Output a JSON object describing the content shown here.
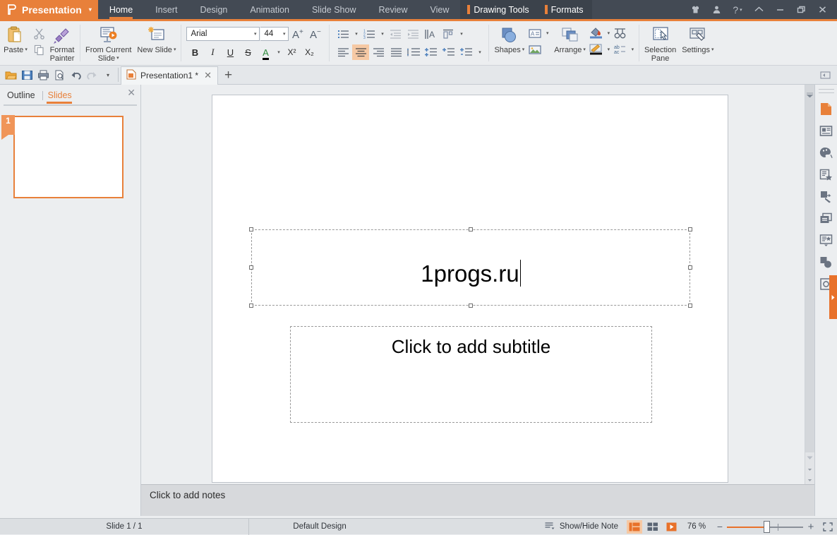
{
  "app": {
    "brand": "Presentation",
    "brand_caret": "▾",
    "accent": "#e8803a",
    "titlebar_bg": "#434a54"
  },
  "titlebar": {
    "tabs": [
      {
        "label": "Home",
        "active": true
      },
      {
        "label": "Insert",
        "active": false
      },
      {
        "label": "Design",
        "active": false
      },
      {
        "label": "Animation",
        "active": false
      },
      {
        "label": "Slide Show",
        "active": false
      },
      {
        "label": "Review",
        "active": false
      },
      {
        "label": "View",
        "active": false
      }
    ],
    "context_tabs": [
      {
        "label": "Drawing Tools"
      },
      {
        "label": "Formats"
      }
    ],
    "controls": [
      {
        "name": "skin-icon"
      },
      {
        "name": "user-account-icon"
      },
      {
        "name": "help-icon"
      },
      {
        "name": "collapse-ribbon-icon"
      },
      {
        "name": "minimize-icon"
      },
      {
        "name": "restore-icon"
      },
      {
        "name": "close-icon"
      }
    ]
  },
  "ribbon": {
    "paste": "Paste",
    "paste_caret": "▾",
    "cut": "cut-scissors-icon",
    "copy": "copy-icon",
    "format_painter_line1": "Format",
    "format_painter_line2": "Painter",
    "from_current_line1": "From Current",
    "from_current_line2": "Slide",
    "from_current_caret": "▾",
    "new_slide": "New Slide",
    "new_slide_caret": "▾",
    "font_name": "Arial",
    "font_size": "44",
    "grow_font": "A⁺",
    "shrink_font": "A⁻",
    "bold": "B",
    "italic": "I",
    "underline": "U",
    "strike": "S",
    "font_color": "A",
    "superscript": "X²",
    "subscript": "X₂",
    "shapes": "Shapes",
    "shapes_caret": "▾",
    "arrange": "Arrange",
    "arrange_caret": "▾",
    "selection_pane_line1": "Selection",
    "selection_pane_line2": "Pane",
    "settings": "Settings",
    "settings_caret": "▾"
  },
  "qat": {
    "buttons": [
      {
        "name": "open-icon"
      },
      {
        "name": "save-icon"
      },
      {
        "name": "print-icon"
      },
      {
        "name": "print-preview-icon"
      },
      {
        "name": "undo-icon"
      },
      {
        "name": "redo-icon"
      },
      {
        "name": "customize-qat-caret"
      }
    ],
    "doc_tab": "Presentation1 *",
    "doc_tab_close": "✕",
    "new_tab": "+"
  },
  "left_panel": {
    "tab_outline": "Outline",
    "tab_slides": "Slides",
    "active_tab": "Slides",
    "close": "✕",
    "slides": [
      {
        "number": "1"
      }
    ]
  },
  "slide": {
    "title_text": "1progs.ru",
    "subtitle_placeholder": "Click to add subtitle",
    "title_selected": true
  },
  "notes": {
    "placeholder": "Click to add notes"
  },
  "right_rail": {
    "buttons": [
      {
        "name": "slide-setup-icon",
        "active": true
      },
      {
        "name": "slide-layout-icon",
        "active": false
      },
      {
        "name": "design-palette-icon",
        "active": false
      },
      {
        "name": "animation-star-icon",
        "active": false
      },
      {
        "name": "insert-object-icon",
        "active": false
      },
      {
        "name": "window-arrange-icon",
        "active": false
      },
      {
        "name": "template-star-icon",
        "active": false
      },
      {
        "name": "shape-style-icon",
        "active": false
      },
      {
        "name": "image-transform-icon",
        "active": false
      }
    ]
  },
  "status": {
    "slide_count": "Slide 1 / 1",
    "design": "Default Design",
    "show_hide_note": "Show/Hide Note",
    "zoom_level": "76 %",
    "zoom_out": "−",
    "zoom_in": "+",
    "views": [
      {
        "name": "normal-view-icon",
        "active": true
      },
      {
        "name": "slide-sorter-icon",
        "active": false
      },
      {
        "name": "slideshow-icon",
        "active": false
      }
    ],
    "fit_window": "fit-to-window-icon"
  }
}
